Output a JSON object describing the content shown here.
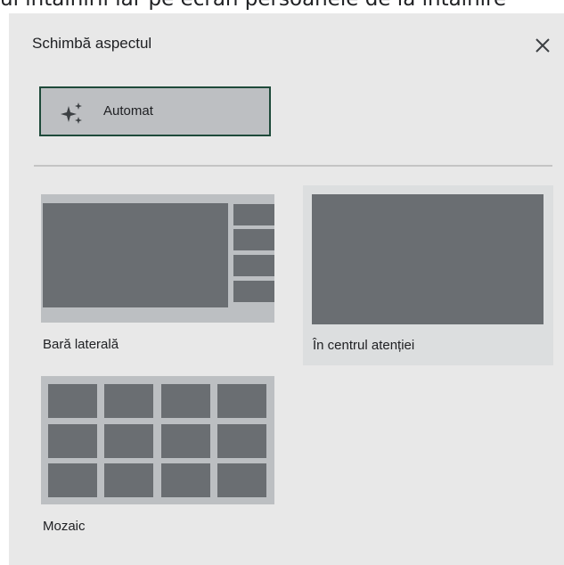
{
  "background_text": "ul întâlnirii iar pe ecran persoanele de la întâlnire",
  "dialog": {
    "title": "Schimbă aspectul",
    "close_icon": "close-icon"
  },
  "auto_option": {
    "label": "Automat",
    "icon": "sparkle-icon",
    "selected": true
  },
  "layouts": [
    {
      "label": "Bară laterală",
      "preview": "sidebar-layout"
    },
    {
      "label": "În centrul atenției",
      "preview": "spotlight-layout"
    },
    {
      "label": "Mozaic",
      "preview": "tiled-layout"
    }
  ],
  "colors": {
    "dialog_bg": "#e8e8e8",
    "selected_border": "#1e4a3a",
    "thumb_bg": "#bcbfc2",
    "tile": "#6a6e72",
    "hover_bg": "#dcdedf"
  }
}
